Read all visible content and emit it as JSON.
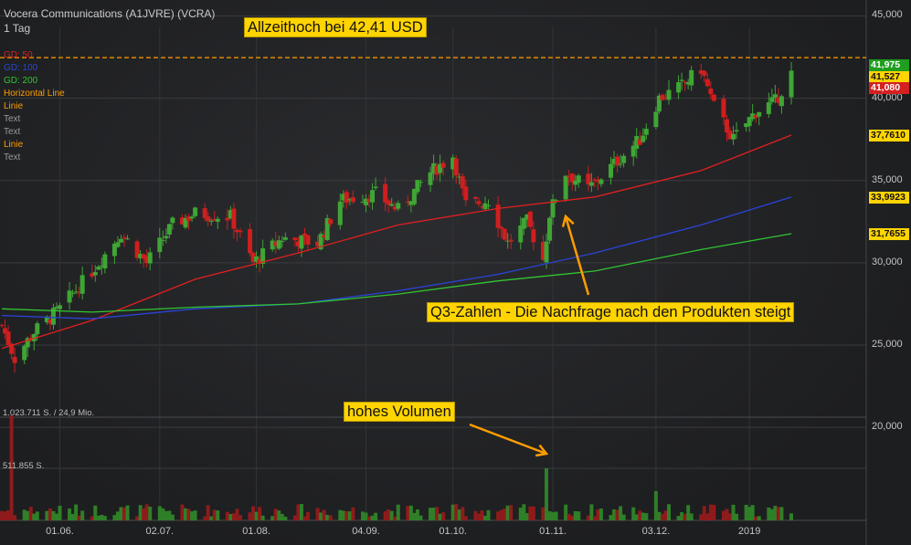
{
  "header": {
    "title": "Vocera Communications (A1JVRE) (VCRA)",
    "interval": "1 Tag"
  },
  "legend": [
    {
      "label": "GD: 50",
      "color": "#e02020"
    },
    {
      "label": "GD: 100",
      "color": "#2a44d8"
    },
    {
      "label": "GD: 200",
      "color": "#31c531"
    },
    {
      "label": "Horizontal Line",
      "color": "#ff9d00"
    },
    {
      "label": "Linie",
      "color": "#ff9d00"
    },
    {
      "label": "Text",
      "color": "#9a9a9a"
    },
    {
      "label": "Text",
      "color": "#9a9a9a"
    },
    {
      "label": "Linie",
      "color": "#ff9d00"
    },
    {
      "label": "Text",
      "color": "#9a9a9a"
    }
  ],
  "annotations": {
    "ath": "Allzeithoch bei 42,41 USD",
    "q3": "Q3-Zahlen - Die Nachfrage nach den Produkten steigt",
    "volume": "hohes Volumen"
  },
  "volume_info": {
    "top": "1.023.711 S. / 24,9 Mio.",
    "mid": "511.855 S."
  },
  "price_tags": [
    {
      "label": "41,975",
      "bg": "#1f9e1f",
      "fg": "#ffffff"
    },
    {
      "label": "41,527",
      "bg": "#ffd400",
      "fg": "#111111"
    },
    {
      "label": "41,080",
      "bg": "#d42020",
      "fg": "#ffffff"
    },
    {
      "label": "37,7610",
      "bg": "#ffd400",
      "fg": "#111111"
    },
    {
      "label": "33,9923",
      "bg": "#ffd400",
      "fg": "#111111"
    },
    {
      "label": "31,7655",
      "bg": "#ffd400",
      "fg": "#111111"
    }
  ],
  "chart_data": {
    "type": "candlestick",
    "title": "Vocera Communications (A1JVRE) (VCRA)",
    "y_ticks": [
      "45,000",
      "40,000",
      "35,000",
      "30,000",
      "25,000",
      "20,000"
    ],
    "y_tick_values": [
      45,
      40,
      35,
      30,
      25,
      20
    ],
    "x_ticks": [
      "01.06.",
      "02.07.",
      "01.08.",
      "04.09.",
      "01.10.",
      "01.11.",
      "03.12.",
      "2019"
    ],
    "ylim": [
      20,
      46
    ],
    "all_time_high": 42.41,
    "price_path": [
      {
        "date": "2018-05-14",
        "close": 26.2
      },
      {
        "date": "2018-05-18",
        "close": 24.2
      },
      {
        "date": "2018-05-24",
        "close": 25.8
      },
      {
        "date": "2018-06-01",
        "close": 27.2
      },
      {
        "date": "2018-06-11",
        "close": 29.5
      },
      {
        "date": "2018-06-20",
        "close": 31.8
      },
      {
        "date": "2018-06-28",
        "close": 30.0
      },
      {
        "date": "2018-07-06",
        "close": 32.3
      },
      {
        "date": "2018-07-13",
        "close": 33.0
      },
      {
        "date": "2018-07-24",
        "close": 32.8
      },
      {
        "date": "2018-07-31",
        "close": 30.0
      },
      {
        "date": "2018-08-09",
        "close": 31.5
      },
      {
        "date": "2018-08-20",
        "close": 31.2
      },
      {
        "date": "2018-08-27",
        "close": 33.8
      },
      {
        "date": "2018-09-07",
        "close": 34.2
      },
      {
        "date": "2018-09-14",
        "close": 33.2
      },
      {
        "date": "2018-09-24",
        "close": 35.5
      },
      {
        "date": "2018-10-01",
        "close": 36.5
      },
      {
        "date": "2018-10-05",
        "close": 33.5
      },
      {
        "date": "2018-10-12",
        "close": 33.8
      },
      {
        "date": "2018-10-18",
        "close": 31.2
      },
      {
        "date": "2018-10-24",
        "close": 32.5
      },
      {
        "date": "2018-10-29",
        "close": 30.2
      },
      {
        "date": "2018-10-31",
        "close": 33.0
      },
      {
        "date": "2018-11-05",
        "close": 35.5
      },
      {
        "date": "2018-11-12",
        "close": 34.5
      },
      {
        "date": "2018-11-20",
        "close": 36.0
      },
      {
        "date": "2018-11-28",
        "close": 37.5
      },
      {
        "date": "2018-12-04",
        "close": 40.0
      },
      {
        "date": "2018-12-10",
        "close": 40.6
      },
      {
        "date": "2018-12-17",
        "close": 41.8
      },
      {
        "date": "2018-12-21",
        "close": 39.5
      },
      {
        "date": "2018-12-27",
        "close": 37.5
      },
      {
        "date": "2019-01-03",
        "close": 39.2
      },
      {
        "date": "2019-01-09",
        "close": 39.8
      },
      {
        "date": "2019-01-14",
        "close": 41.5
      }
    ],
    "series": [
      {
        "name": "GD: 50",
        "last": 37.761,
        "path": [
          {
            "date": "2018-05-14",
            "value": 24.8
          },
          {
            "date": "2018-06-11",
            "value": 26.5
          },
          {
            "date": "2018-07-13",
            "value": 29.0
          },
          {
            "date": "2018-08-14",
            "value": 30.6
          },
          {
            "date": "2018-09-14",
            "value": 32.3
          },
          {
            "date": "2018-10-15",
            "value": 33.3
          },
          {
            "date": "2018-11-14",
            "value": 34.0
          },
          {
            "date": "2018-12-17",
            "value": 35.6
          },
          {
            "date": "2019-01-14",
            "value": 37.761
          }
        ]
      },
      {
        "name": "GD: 100",
        "last": 33.9923,
        "path": [
          {
            "date": "2018-05-14",
            "value": 26.8
          },
          {
            "date": "2018-06-11",
            "value": 26.6
          },
          {
            "date": "2018-07-13",
            "value": 27.2
          },
          {
            "date": "2018-08-14",
            "value": 27.5
          },
          {
            "date": "2018-09-14",
            "value": 28.3
          },
          {
            "date": "2018-10-15",
            "value": 29.3
          },
          {
            "date": "2018-11-14",
            "value": 30.6
          },
          {
            "date": "2018-12-17",
            "value": 32.3
          },
          {
            "date": "2019-01-14",
            "value": 33.9923
          }
        ]
      },
      {
        "name": "GD: 200",
        "last": 31.7655,
        "path": [
          {
            "date": "2018-05-14",
            "value": 27.2
          },
          {
            "date": "2018-06-11",
            "value": 27.0
          },
          {
            "date": "2018-07-13",
            "value": 27.3
          },
          {
            "date": "2018-08-14",
            "value": 27.5
          },
          {
            "date": "2018-09-14",
            "value": 28.1
          },
          {
            "date": "2018-10-15",
            "value": 28.9
          },
          {
            "date": "2018-11-14",
            "value": 29.5
          },
          {
            "date": "2018-12-17",
            "value": 30.8
          },
          {
            "date": "2019-01-14",
            "value": 31.7655
          }
        ]
      }
    ]
  }
}
